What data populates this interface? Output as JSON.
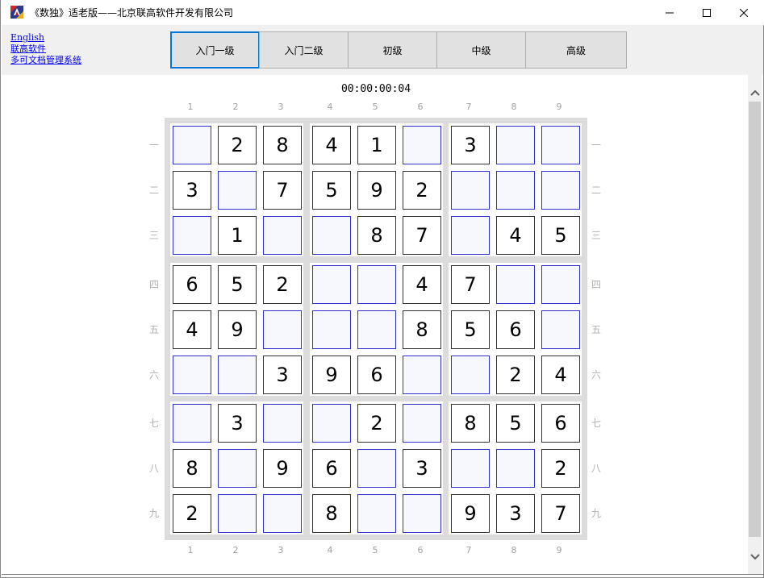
{
  "window": {
    "title": "《数独》适老版——北京联高软件开发有限公司",
    "icon": "app-logo-icon",
    "controls": [
      "minimize-icon",
      "maximize-icon",
      "close-icon"
    ]
  },
  "links": {
    "english": "English",
    "company": "联高软件",
    "doc_system": "多可文档管理系统"
  },
  "levels": [
    {
      "label": "入门一级",
      "active": true
    },
    {
      "label": "入门二级",
      "active": false
    },
    {
      "label": "初级",
      "active": false
    },
    {
      "label": "中级",
      "active": false
    },
    {
      "label": "高级",
      "active": false
    }
  ],
  "timer": "00:00:00:04",
  "column_labels": [
    "1",
    "2",
    "3",
    "4",
    "5",
    "6",
    "7",
    "8",
    "9"
  ],
  "row_labels": [
    "一",
    "二",
    "三",
    "四",
    "五",
    "六",
    "七",
    "八",
    "九"
  ],
  "board": [
    [
      "",
      "2",
      "8",
      "4",
      "1",
      "",
      "3",
      "",
      ""
    ],
    [
      "3",
      "",
      "7",
      "5",
      "9",
      "2",
      "",
      "",
      ""
    ],
    [
      "",
      "1",
      "",
      "",
      "8",
      "7",
      "",
      "4",
      "5"
    ],
    [
      "6",
      "5",
      "2",
      "",
      "",
      "4",
      "7",
      "",
      ""
    ],
    [
      "4",
      "9",
      "",
      "",
      "",
      "8",
      "5",
      "6",
      ""
    ],
    [
      "",
      "",
      "3",
      "9",
      "6",
      "",
      "",
      "2",
      "4"
    ],
    [
      "",
      "3",
      "",
      "",
      "2",
      "",
      "8",
      "5",
      "6"
    ],
    [
      "8",
      "",
      "9",
      "6",
      "",
      "3",
      "",
      "",
      "2"
    ],
    [
      "2",
      "",
      "",
      "8",
      "",
      "",
      "9",
      "3",
      "7"
    ]
  ],
  "colors": {
    "empty_cell_border": "#3030cc",
    "empty_cell_fill": "#f6f8fe",
    "given_cell_border": "#333333",
    "board_frame": "#dcdcdc",
    "active_tab_border": "#0078d7",
    "link": "#0000ee"
  }
}
